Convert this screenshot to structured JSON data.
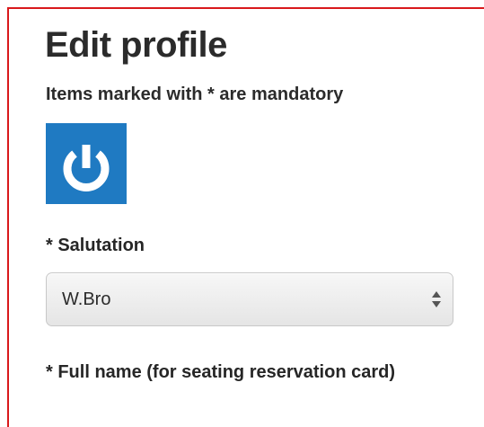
{
  "form": {
    "title": "Edit profile",
    "mandatory_note": "Items marked with * are mandatory",
    "avatar_icon": "power-icon",
    "colors": {
      "frame_border": "#d9191c",
      "avatar_bg": "#1f7ac2"
    },
    "salutation": {
      "label": "* Salutation",
      "value": "W.Bro"
    },
    "full_name": {
      "label": "* Full name (for seating reservation card)"
    }
  }
}
